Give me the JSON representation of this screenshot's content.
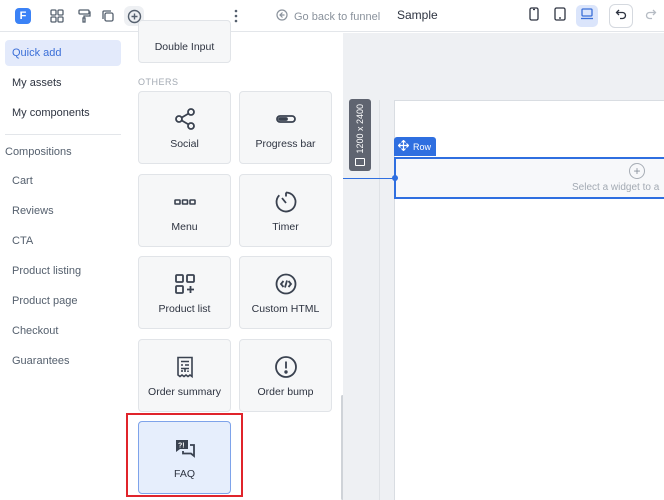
{
  "topbar": {
    "logo_letter": "F",
    "back_label": "Go back to funnel",
    "page_title": "Sample"
  },
  "sidebar": {
    "items": [
      {
        "label": "Quick add",
        "active": true
      },
      {
        "label": "My assets",
        "active": false
      },
      {
        "label": "My components",
        "active": false
      }
    ],
    "section_title": "Compositions",
    "compositions": [
      "Cart",
      "Reviews",
      "CTA",
      "Product listing",
      "Product page",
      "Checkout",
      "Guarantees"
    ]
  },
  "panel": {
    "partial_card_label": "Double Input",
    "section_label": "OTHERS",
    "widgets": [
      {
        "label": "Social",
        "icon": "share-icon"
      },
      {
        "label": "Progress bar",
        "icon": "progress-bar-icon"
      },
      {
        "label": "Menu",
        "icon": "menu-icon"
      },
      {
        "label": "Timer",
        "icon": "timer-icon"
      },
      {
        "label": "Product list",
        "icon": "product-list-icon"
      },
      {
        "label": "Custom HTML",
        "icon": "code-icon"
      },
      {
        "label": "Order summary",
        "icon": "receipt-icon"
      },
      {
        "label": "Order bump",
        "icon": "exclamation-icon"
      },
      {
        "label": "FAQ",
        "icon": "faq-icon",
        "selected": true
      }
    ]
  },
  "canvas": {
    "size_label": "1200 x 2400",
    "row_label": "Row",
    "row_hint": "Select a widget to a"
  },
  "colors": {
    "accent": "#2f6fe0",
    "highlight": "#e0242b"
  }
}
